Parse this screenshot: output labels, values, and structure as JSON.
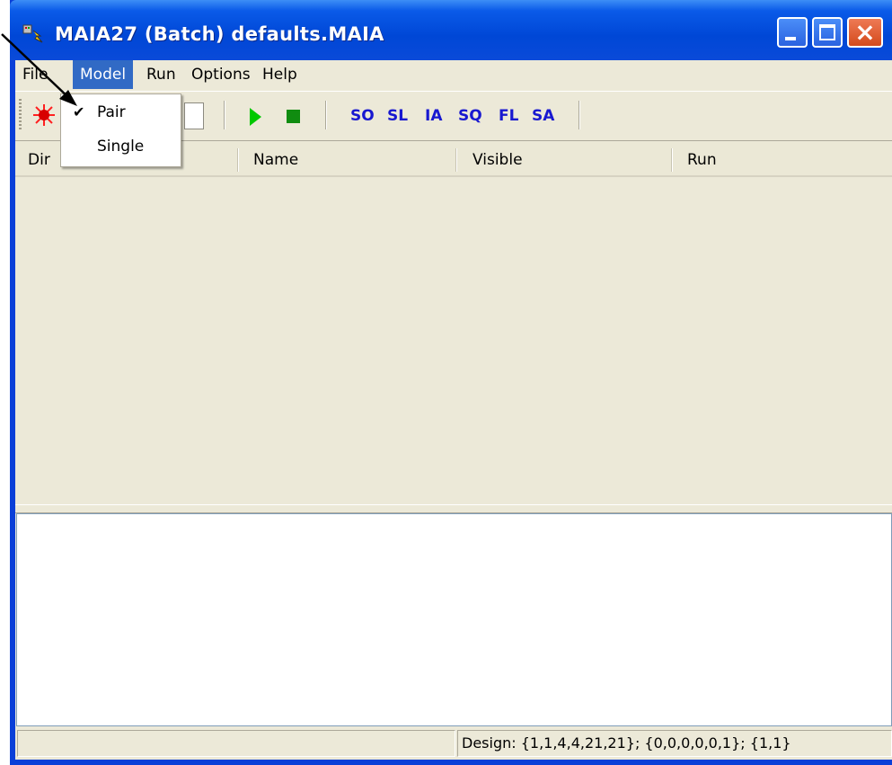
{
  "window": {
    "title": "MAIA27 (Batch) defaults.MAIA"
  },
  "menubar": {
    "items": [
      {
        "label": "File"
      },
      {
        "label": "Model"
      },
      {
        "label": "Run"
      },
      {
        "label": "Options"
      },
      {
        "label": "Help"
      }
    ]
  },
  "model_menu": {
    "items": [
      {
        "label": "Pair",
        "checked": true
      },
      {
        "label": "Single",
        "checked": false
      }
    ]
  },
  "toolbar": {
    "icons": [
      "bug-icon",
      "box-icon",
      "play-icon",
      "stop-icon"
    ],
    "text_buttons": [
      "SO",
      "SL",
      "IA",
      "SQ",
      "FL",
      "SA"
    ],
    "text_color": "#1818d0"
  },
  "list": {
    "columns": [
      "Dir",
      "Name",
      "Visible",
      "Run"
    ]
  },
  "statusbar": {
    "panel1": "",
    "panel2": "Design: {1,1,4,4,21,21}; {0,0,0,0,0,1}; {1,1}"
  },
  "colors": {
    "title_bar": "#0047d6",
    "menu_highlight": "#316ac5",
    "face": "#ece9d8"
  }
}
